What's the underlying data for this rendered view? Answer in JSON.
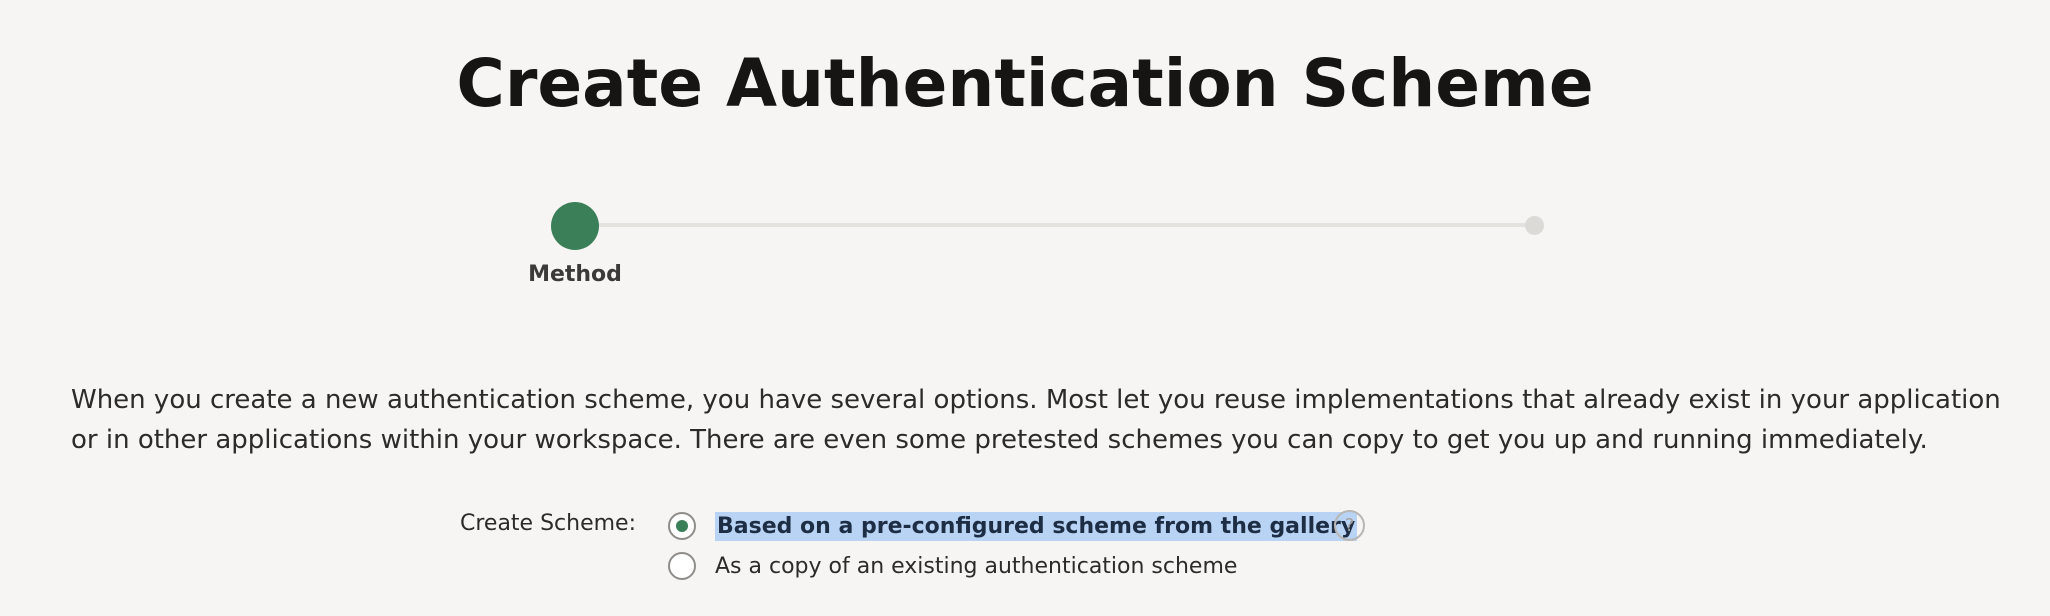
{
  "page": {
    "title": "Create Authentication Scheme"
  },
  "wizard": {
    "steps": [
      {
        "label": "Method",
        "state": "active"
      },
      {
        "label": "",
        "state": "upcoming"
      }
    ],
    "active_color": "#3a7f57"
  },
  "description": "When you create a new authentication scheme, you have several options. Most let you reuse implementations that already exist in your application or in other applications within your workspace. There are even some pretested schemes you can copy to get you up and running immediately.",
  "form": {
    "create_scheme": {
      "label": "Create Scheme:",
      "options": [
        {
          "label": "Based on a pre-configured scheme from the gallery",
          "selected": true
        },
        {
          "label": "As a copy of an existing authentication scheme",
          "selected": false
        }
      ],
      "help_icon": "question-mark",
      "help_symbol": "?"
    }
  }
}
